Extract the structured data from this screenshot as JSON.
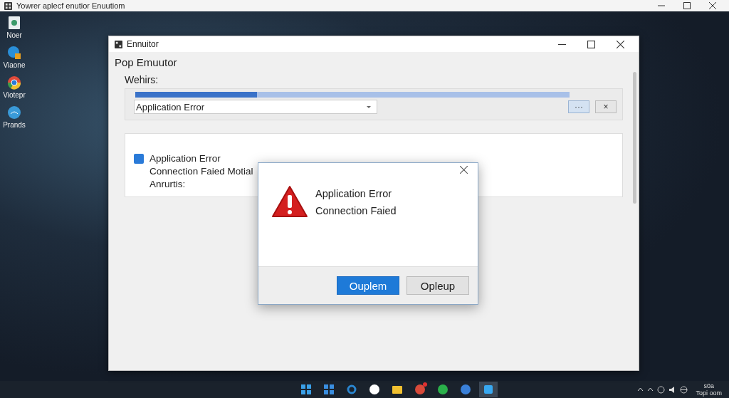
{
  "screen_title": "Yowrer aplecf enutior Enuutiom",
  "desktop_icons": [
    {
      "label": "Noer",
      "kind": "document"
    },
    {
      "label": "Viaone",
      "kind": "browser"
    },
    {
      "label": "Viotepr",
      "kind": "chrome"
    },
    {
      "label": "Prands",
      "kind": "globe"
    }
  ],
  "window": {
    "title": "Ennuitor",
    "heading": "Pop Emuutor",
    "field_label": "Wehirs:",
    "progress": {
      "level": 0.28
    },
    "dropdown": {
      "value": "Application Error"
    },
    "buttons": [
      {
        "label": "···",
        "selected": true
      },
      {
        "label": "×",
        "selected": false
      }
    ],
    "message": {
      "title": "Application Error",
      "lines": [
        "Connection Faied Motial",
        "Anrurtis:"
      ]
    }
  },
  "dialog": {
    "lines": [
      "Application Error",
      "Connection Faied"
    ],
    "buttons": [
      {
        "label": "Ouplem",
        "selected": true
      },
      {
        "label": "Opleup",
        "selected": false
      }
    ]
  },
  "taskbar": {
    "apps": [
      {
        "kind": "start"
      },
      {
        "kind": "widgets"
      },
      {
        "kind": "search"
      },
      {
        "kind": "chat"
      },
      {
        "kind": "folder"
      },
      {
        "kind": "store",
        "badge": true
      },
      {
        "kind": "green"
      },
      {
        "kind": "camera"
      },
      {
        "kind": "active"
      }
    ],
    "clock": {
      "time": "s0a",
      "date": "Topi oom"
    }
  }
}
